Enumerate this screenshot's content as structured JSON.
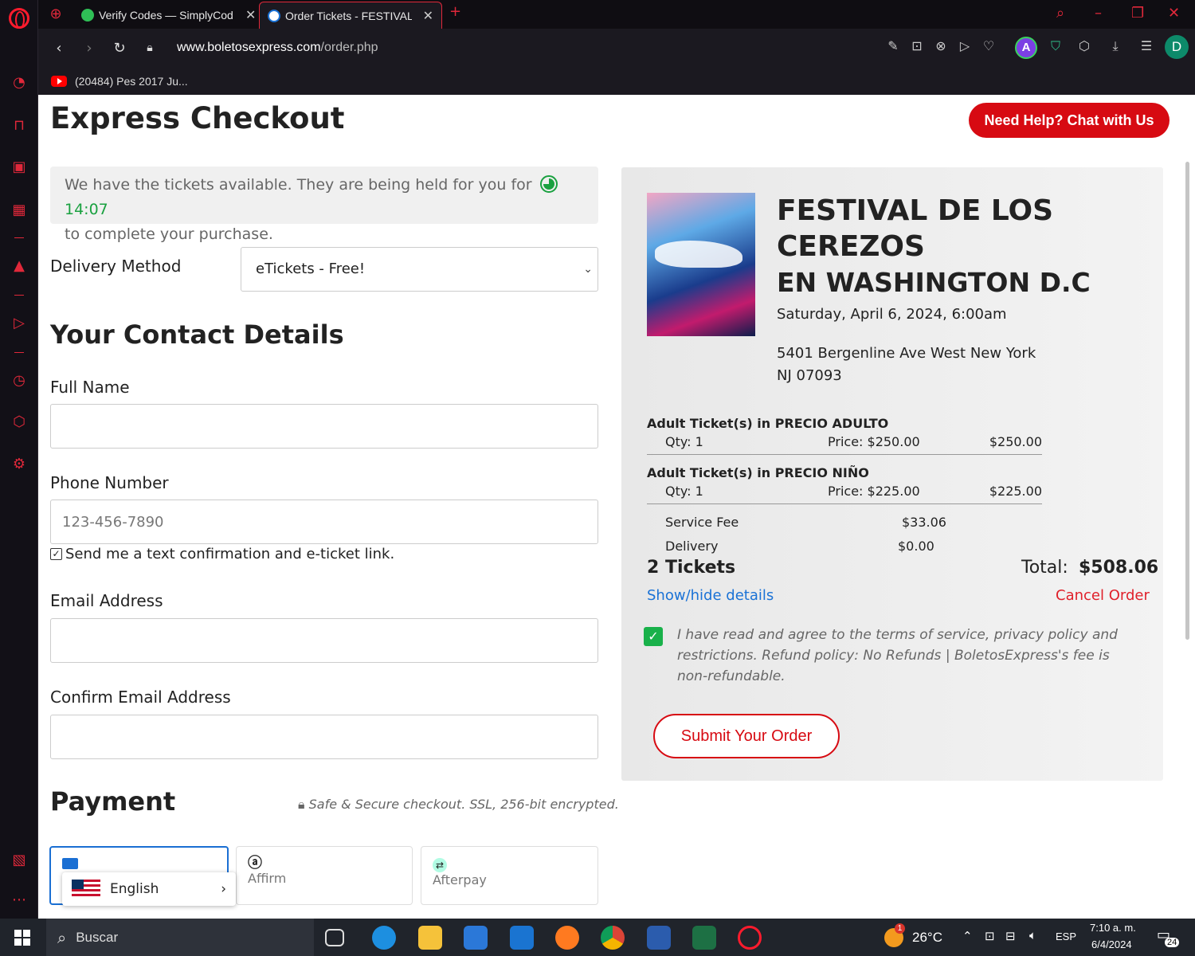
{
  "browser": {
    "tabs": [
      {
        "label": "Verify Codes — SimplyCod",
        "active": false
      },
      {
        "label": "Order Tickets - FESTIVAL D",
        "active": true
      }
    ],
    "url_domain": "www.boletosexpress.com",
    "url_path": "/order.php",
    "bookmark": "(20484) Pes 2017 Ju...",
    "avatar_a": "A",
    "avatar_d": "D",
    "icons": [
      "easy-setup-icon",
      "camera-icon",
      "close-circle-icon",
      "send-icon",
      "heart-icon",
      "vpn-shield-icon",
      "cube-icon",
      "download-icon",
      "menu-icon"
    ]
  },
  "page": {
    "title": "Express Checkout",
    "help_button": "Need Help? Chat with Us",
    "hold_text_1": "We have the tickets available. They are being held for you for",
    "hold_timer": "14:07",
    "hold_text_2": "to complete your purchase.",
    "delivery_label": "Delivery Method",
    "delivery_value": "eTickets - Free!",
    "contact_heading": "Your Contact Details",
    "full_name_label": "Full Name",
    "full_name_value": "",
    "phone_label": "Phone Number",
    "phone_placeholder": "123-456-7890",
    "text_confirm": "Send me a text confirmation and e-ticket link.",
    "email_label": "Email Address",
    "confirm_email_label": "Confirm Email Address",
    "payment_heading": "Payment",
    "secure_text": "Safe & Secure checkout. SSL, 256-bit encrypted.",
    "payment_tabs": [
      {
        "label": "",
        "icon": "card-icon"
      },
      {
        "label": "Affirm",
        "icon": "affirm-icon"
      },
      {
        "label": "Afterpay",
        "icon": "afterpay-icon"
      }
    ],
    "language_popup": "English"
  },
  "summary": {
    "event_title_1": "FESTIVAL DE LOS",
    "event_title_2": "CEREZOS",
    "event_title_3": "EN WASHINGTON D.C",
    "event_date": "Saturday, April 6, 2024, 6:00am",
    "address_1": "5401 Bergenline Ave West New York",
    "address_2": "NJ 07093",
    "line_items": [
      {
        "heading": "Adult Ticket(s) in PRECIO ADULTO",
        "qty": "Qty: 1",
        "price": "Price: $250.00",
        "amount": "$250.00"
      },
      {
        "heading": "Adult Ticket(s) in PRECIO NIÑO",
        "qty": "Qty: 1",
        "price": "Price: $225.00",
        "amount": "$225.00"
      }
    ],
    "service_fee_label": "Service Fee",
    "service_fee_value": "$33.06",
    "delivery_label": "Delivery",
    "delivery_value": "$0.00",
    "tickets_count": "2 Tickets",
    "total_label": "Total:",
    "total_value": "$508.06",
    "show_hide": "Show/hide details",
    "cancel": "Cancel Order",
    "agree_text": "I have read and agree to the terms of service, privacy policy and restrictions. Refund policy: No Refunds | BoletosExpress's fee is non-refundable.",
    "agree_checked": true,
    "submit": "Submit Your Order"
  },
  "taskbar": {
    "search": "Buscar",
    "weather": "26°C",
    "weather_badge": "1",
    "lang": "ESP",
    "time": "7:10 a. m.",
    "date": "6/4/2024",
    "notif_count": "24"
  },
  "colors": {
    "accent_red": "#d70a12",
    "link_blue": "#1a72d6",
    "timer_green": "#1aa140",
    "opera_red": "#ff1b2d"
  }
}
